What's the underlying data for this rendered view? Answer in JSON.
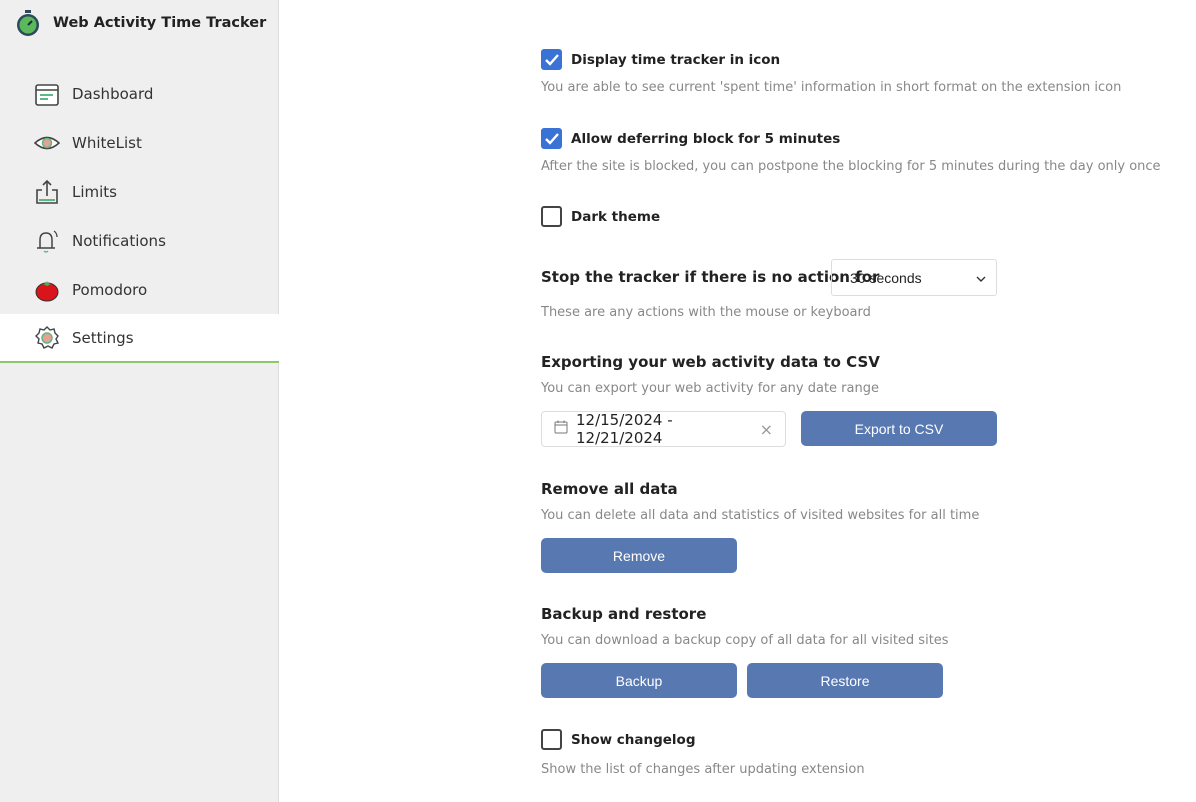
{
  "app": {
    "title": "Web Activity Time Tracker",
    "logo_icon": "stopwatch-icon"
  },
  "sidebar": {
    "items": [
      {
        "label": "Dashboard",
        "icon": "calendar-icon"
      },
      {
        "label": "WhiteList",
        "icon": "eye-icon"
      },
      {
        "label": "Limits",
        "icon": "upload-icon"
      },
      {
        "label": "Notifications",
        "icon": "bell-icon"
      },
      {
        "label": "Pomodoro",
        "icon": "tomato-icon"
      },
      {
        "label": "Settings",
        "icon": "gear-icon",
        "active": true
      }
    ]
  },
  "settings": {
    "display_icon": {
      "label": "Display time tracker in icon",
      "checked": true,
      "desc": "You are able to see current 'spent time' information in short format on the extension icon"
    },
    "defer": {
      "label": "Allow deferring block for 5 minutes",
      "checked": true,
      "desc": "After the site is blocked, you can postpone the blocking for 5 minutes during the day only once"
    },
    "dark": {
      "label": "Dark theme",
      "checked": false
    },
    "stop": {
      "label": "Stop the tracker if there is no action for",
      "value": "30 seconds",
      "desc": "These are any actions with the mouse or keyboard"
    },
    "export": {
      "title": "Exporting your web activity data to CSV",
      "desc": "You can export your web activity for any date range",
      "range": "12/15/2024 - 12/21/2024",
      "button": "Export to CSV"
    },
    "remove": {
      "title": "Remove all data",
      "desc": "You can delete all data and statistics of visited websites for all time",
      "button": "Remove"
    },
    "backup": {
      "title": "Backup and restore",
      "desc": "You can download a backup copy of all data for all visited sites",
      "backup_button": "Backup",
      "restore_button": "Restore"
    },
    "changelog": {
      "label": "Show changelog",
      "checked": false,
      "desc": "Show the list of changes after updating extension"
    }
  },
  "colors": {
    "accent": "#5778b0",
    "checkbox": "#3a73d6",
    "active_underline": "#8fc66a"
  }
}
